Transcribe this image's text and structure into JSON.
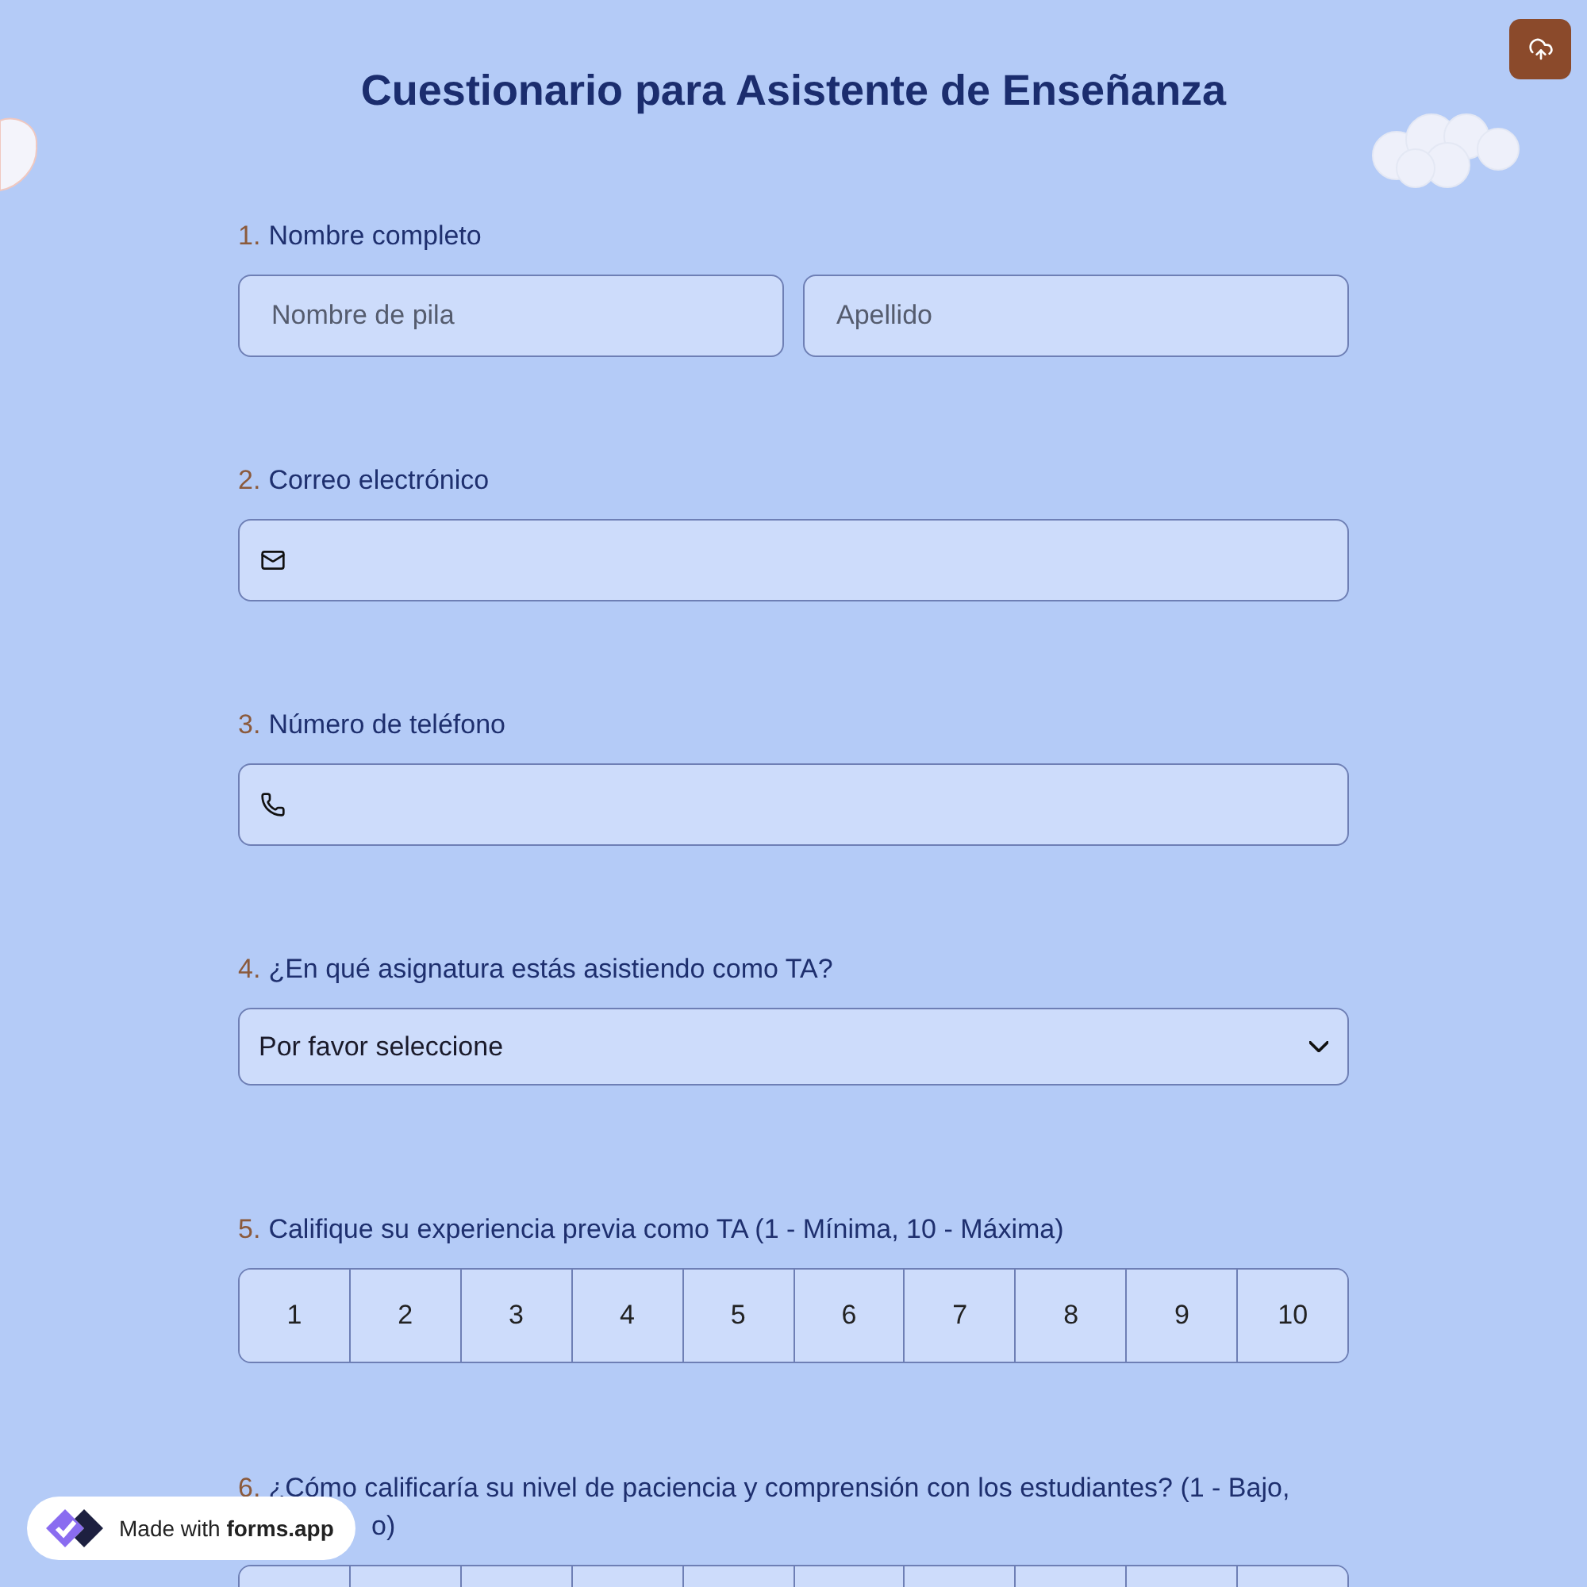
{
  "title": "Cuestionario para Asistente de Enseñanza",
  "questions": [
    {
      "number": "1.",
      "label": "Nombre completo",
      "kind": "name",
      "fields": [
        {
          "placeholder": "Nombre de pila"
        },
        {
          "placeholder": "Apellido"
        }
      ]
    },
    {
      "number": "2.",
      "label": "Correo electrónico",
      "kind": "email"
    },
    {
      "number": "3.",
      "label": "Número de teléfono",
      "kind": "phone"
    },
    {
      "number": "4.",
      "label": "¿En qué asignatura estás asistiendo como TA?",
      "kind": "select",
      "value": "Por favor seleccione"
    },
    {
      "number": "5.",
      "label": "Califique su experiencia previa como TA (1 - Mínima, 10 - Máxima)",
      "kind": "scale",
      "options": [
        {
          "label": "1",
          "selected": false
        },
        {
          "label": "2",
          "selected": false
        },
        {
          "label": "3",
          "selected": false
        },
        {
          "label": "4",
          "selected": false
        },
        {
          "label": "5",
          "selected": false
        },
        {
          "label": "6",
          "selected": false
        },
        {
          "label": "7",
          "selected": false
        },
        {
          "label": "8",
          "selected": false
        },
        {
          "label": "9",
          "selected": false
        },
        {
          "label": "10",
          "selected": false
        }
      ]
    },
    {
      "number": "6.",
      "label": "¿Cómo calificaría su nivel de paciencia y comprensión con los estudiantes? (1 - Bajo,",
      "label_continued": "o)",
      "kind": "scale"
    }
  ],
  "badge": {
    "prefix": "Made with",
    "brand": "forms.app"
  }
}
